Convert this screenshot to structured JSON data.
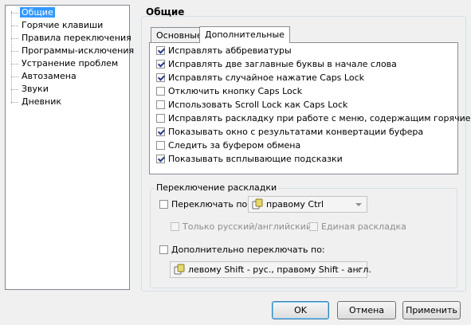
{
  "nav": {
    "items": [
      {
        "label": "Общие",
        "selected": true
      },
      {
        "label": "Горячие клавиши"
      },
      {
        "label": "Правила переключения"
      },
      {
        "label": "Программы-исключения"
      },
      {
        "label": "Устранение проблем"
      },
      {
        "label": "Автозамена"
      },
      {
        "label": "Звуки"
      },
      {
        "label": "Дневник"
      }
    ]
  },
  "panel": {
    "title": "Общие",
    "tabs": [
      {
        "label": "Основные"
      },
      {
        "label": "Дополнительные",
        "active": true
      }
    ],
    "options": [
      {
        "label": "Исправлять аббревиатуры",
        "checked": true
      },
      {
        "label": "Исправлять две заглавные буквы в начале слова",
        "checked": true
      },
      {
        "label": "Исправлять случайное нажатие Caps Lock",
        "checked": true
      },
      {
        "label": "Отключить кнопку Caps Lock",
        "checked": false
      },
      {
        "label": "Использовать Scroll Lock как Caps Lock",
        "checked": false
      },
      {
        "label": "Исправлять раскладку при работе с меню, содержащим горячие ...",
        "checked": false
      },
      {
        "label": "Показывать окно с результатами конвертации буфера",
        "checked": true
      },
      {
        "label": "Следить за буфером обмена",
        "checked": false
      },
      {
        "label": "Показывать всплывающие подсказки",
        "checked": true
      }
    ]
  },
  "layout_switch": {
    "group_title": "Переключение раскладки",
    "switch_by_label": "Переключать по:",
    "switch_by_value": "правому Ctrl",
    "only_ru_en_label": "Только русский/английский",
    "single_layout_label": "Единая раскладка",
    "extra_switch_label": "Дополнительно переключать по:",
    "extra_switch_value": "левому Shift - рус., правому Shift - англ."
  },
  "buttons": {
    "ok": "OK",
    "cancel": "Отмена",
    "apply": "Применить"
  },
  "colors": {
    "selection": "#3399ff",
    "check": "#2a3a8c",
    "window_bg": "#f0f0f0"
  }
}
